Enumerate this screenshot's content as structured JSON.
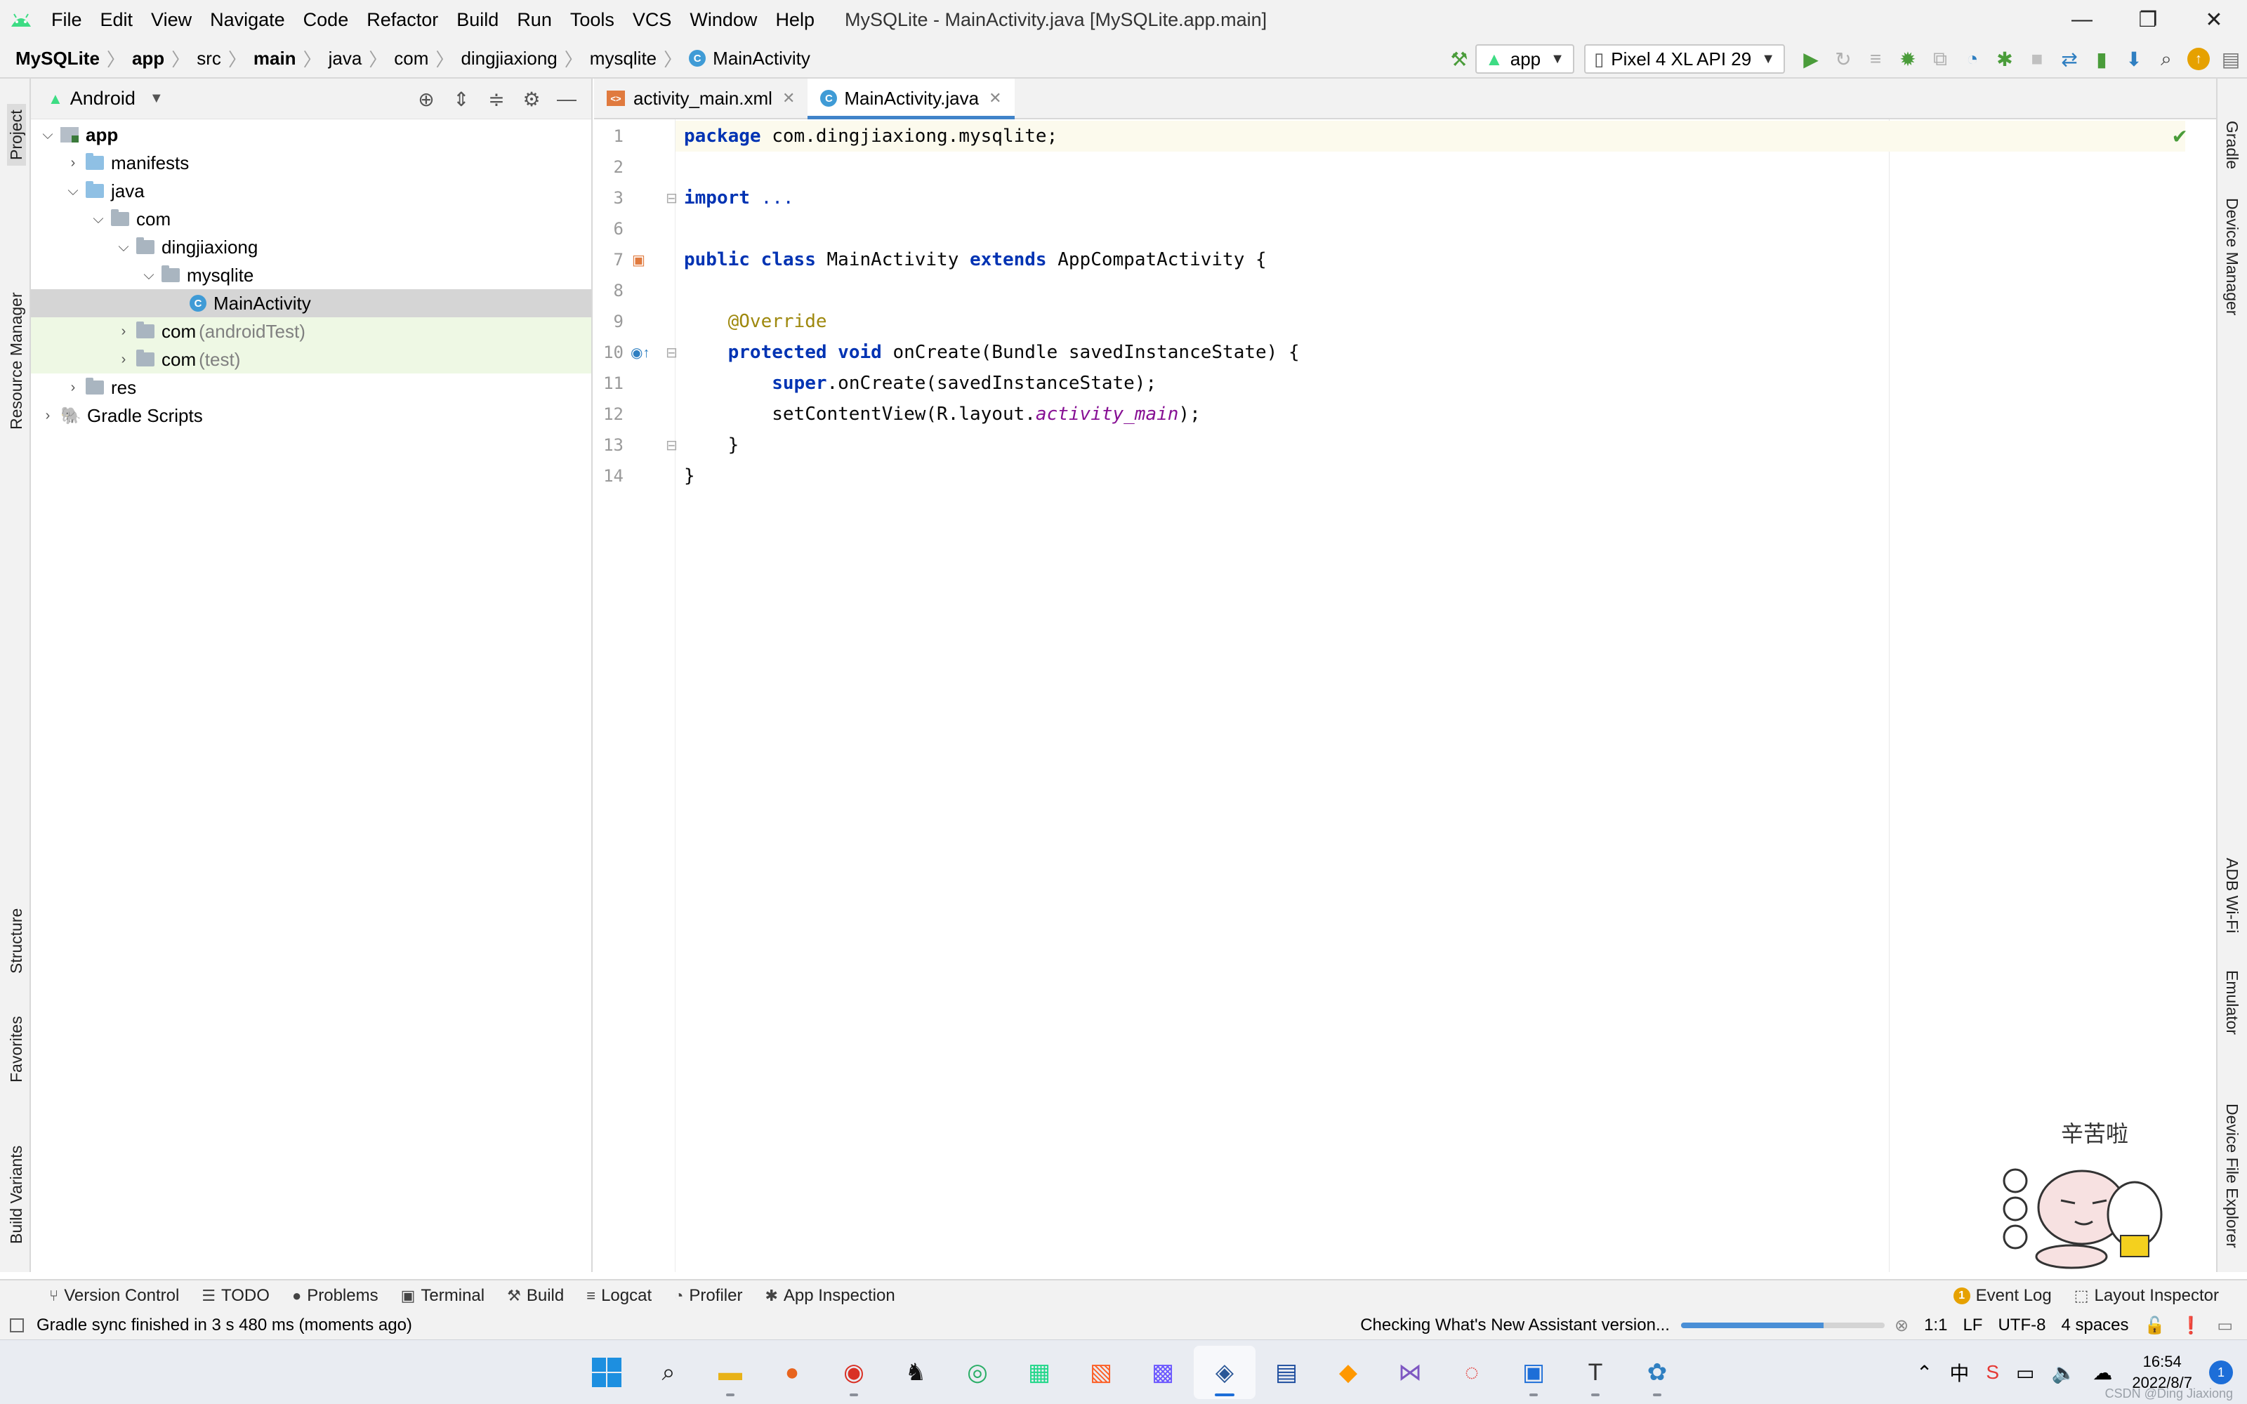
{
  "titlebar": {
    "menu": [
      "File",
      "Edit",
      "View",
      "Navigate",
      "Code",
      "Refactor",
      "Build",
      "Run",
      "Tools",
      "VCS",
      "Window",
      "Help"
    ],
    "window_title": "MySQLite - MainActivity.java [MySQLite.app.main]",
    "controls": {
      "minimize": "—",
      "restore": "❐",
      "close": "✕"
    }
  },
  "breadcrumb": {
    "items": [
      "MySQLite",
      "app",
      "src",
      "main",
      "java",
      "com",
      "dingjiaxiong",
      "mysqlite",
      "MainActivity"
    ],
    "class_badge": "C"
  },
  "toolbar": {
    "config": "app",
    "device": "Pixel 4 XL API 29",
    "accent": "#4a9c3a"
  },
  "left_strip": [
    "Project",
    "Resource Manager",
    "Structure",
    "Favorites",
    "Build Variants"
  ],
  "right_strip": [
    "Gradle",
    "Device Manager",
    "ADB Wi-Fi",
    "Emulator",
    "Device File Explorer"
  ],
  "project": {
    "view": "Android",
    "tree": [
      {
        "label": "app",
        "extra": ""
      },
      {
        "label": "manifests",
        "extra": ""
      },
      {
        "label": "java",
        "extra": ""
      },
      {
        "label": "com",
        "extra": ""
      },
      {
        "label": "dingjiaxiong",
        "extra": ""
      },
      {
        "label": "mysqlite",
        "extra": ""
      },
      {
        "label": "MainActivity",
        "extra": ""
      },
      {
        "label": "com",
        "extra": "(androidTest)"
      },
      {
        "label": "com",
        "extra": "(test)"
      },
      {
        "label": "res",
        "extra": ""
      },
      {
        "label": "Gradle Scripts",
        "extra": ""
      }
    ]
  },
  "editor": {
    "tabs": [
      {
        "label": "activity_main.xml",
        "active": false
      },
      {
        "label": "MainActivity.java",
        "active": true
      }
    ],
    "line_numbers": [
      "1",
      "2",
      "3",
      "6",
      "7",
      "8",
      "9",
      "10",
      "11",
      "12",
      "13",
      "14"
    ],
    "code": {
      "l1_kw": "package",
      "l1_rest": " com.dingjiaxiong.mysqlite;",
      "l3_kw": "import",
      "l3_rest": " ...",
      "l7_kw1": "public",
      "l7_kw2": "class",
      "l7_name": " MainActivity ",
      "l7_kw3": "extends",
      "l7_rest": " AppCompatActivity {",
      "l9_anno": "@Override",
      "l10_kw1": "protected",
      "l10_kw2": "void",
      "l10_rest": " onCreate(Bundle savedInstanceState) {",
      "l11_kw": "super",
      "l11_rest": ".onCreate(savedInstanceState);",
      "l12_a": "setContentView(R.layout.",
      "l12_field": "activity_main",
      "l12_b": ");",
      "l13": "}",
      "l14": "}"
    }
  },
  "sticker": {
    "text": "辛苦啦"
  },
  "tool_windows": [
    "Version Control",
    "TODO",
    "Problems",
    "Terminal",
    "Build",
    "Logcat",
    "Profiler",
    "App Inspection"
  ],
  "tool_right": {
    "event_log": "Event Log",
    "event_count": "1",
    "layout_inspector": "Layout Inspector"
  },
  "status": {
    "message": "Gradle sync finished in 3 s 480 ms (moments ago)",
    "task": "Checking What's New Assistant version...",
    "progress": 0.7,
    "position": "1:1",
    "line_sep": "LF",
    "encoding": "UTF-8",
    "indent": "4 spaces"
  },
  "taskbar": {
    "time": "16:54",
    "date": "2022/8/7",
    "ime": "中",
    "notifications": "1",
    "watermark": "CSDN @Ding Jiaxiong"
  }
}
